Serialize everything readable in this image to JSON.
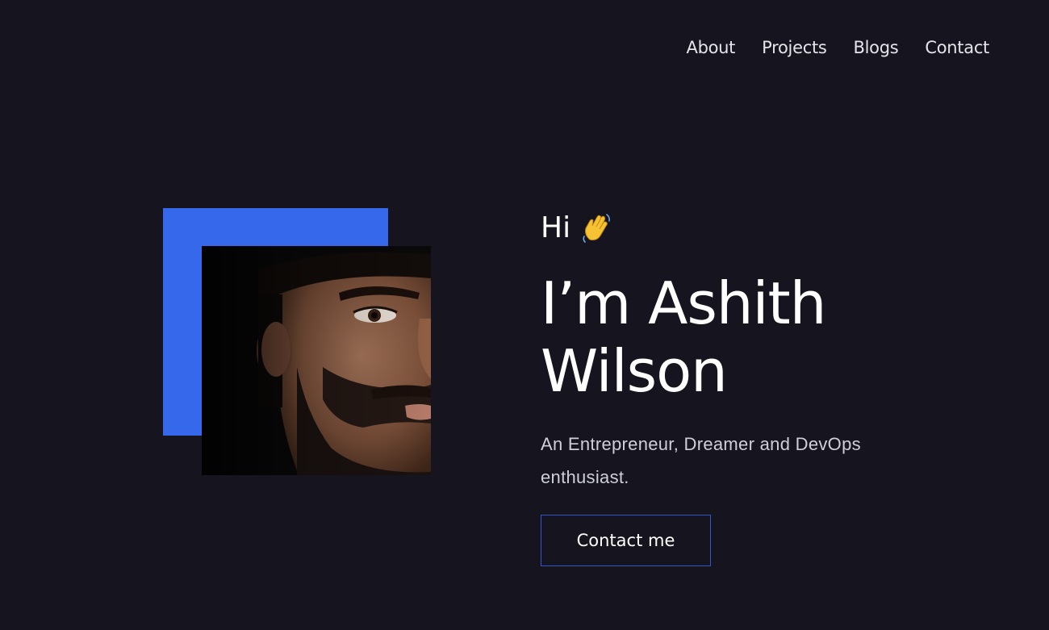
{
  "nav": {
    "items": [
      {
        "label": "About"
      },
      {
        "label": "Projects"
      },
      {
        "label": "Blogs"
      },
      {
        "label": "Contact"
      }
    ]
  },
  "hero": {
    "greeting": "Hi",
    "greeting_icon": "waving-hand-icon",
    "name_line1": "I’m Ashith",
    "name_line2": "Wilson",
    "tagline": "An Entrepreneur, Dreamer and DevOps enthusiast.",
    "cta_label": "Contact me"
  },
  "colors": {
    "background": "#16151f",
    "accent": "#3668eb",
    "cta_border": "#3456c9",
    "text": "#ffffff"
  }
}
